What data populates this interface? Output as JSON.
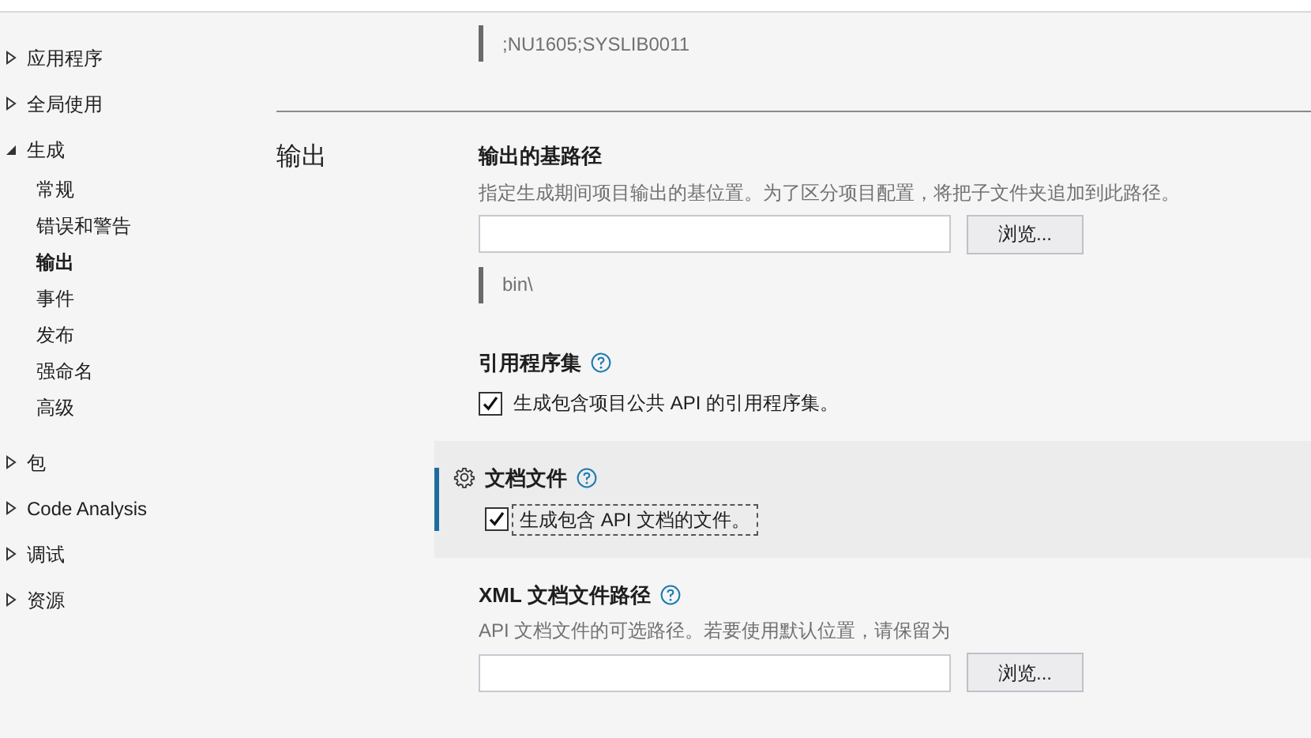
{
  "sidebar": {
    "items": [
      {
        "label": "应用程序",
        "expanded": false,
        "selected": false
      },
      {
        "label": "全局使用",
        "expanded": false,
        "selected": false
      },
      {
        "label": "生成",
        "expanded": true,
        "selected": false,
        "children": [
          {
            "label": "常规",
            "selected": false
          },
          {
            "label": "错误和警告",
            "selected": false
          },
          {
            "label": "输出",
            "selected": true
          },
          {
            "label": "事件",
            "selected": false
          },
          {
            "label": "发布",
            "selected": false
          },
          {
            "label": "强命名",
            "selected": false
          },
          {
            "label": "高级",
            "selected": false
          }
        ]
      },
      {
        "label": "包",
        "expanded": false,
        "selected": false
      },
      {
        "label": "Code Analysis",
        "expanded": false,
        "selected": false
      },
      {
        "label": "调试",
        "expanded": false,
        "selected": false
      },
      {
        "label": "资源",
        "expanded": false,
        "selected": false
      }
    ]
  },
  "top_value": ";NU1605;SYSLIB0011",
  "section": {
    "title": "输出",
    "settings": [
      {
        "kind": "path",
        "title": "输出的基路径",
        "help": false,
        "highlighted": false,
        "description": "指定生成期间项目输出的基位置。为了区分项目配置，将把子文件夹追加到此路径。",
        "button": "浏览...",
        "evaluated": "bin\\"
      },
      {
        "kind": "checkbox",
        "title": "引用程序集",
        "help": true,
        "highlighted": false,
        "label": "生成包含项目公共 API 的引用程序集。",
        "checked": true,
        "focused": false
      },
      {
        "kind": "checkbox",
        "title": "文档文件",
        "help": true,
        "highlighted": true,
        "label": "生成包含 API 文档的文件。",
        "checked": true,
        "focused": true
      },
      {
        "kind": "path",
        "title": "XML 文档文件路径",
        "help": true,
        "highlighted": false,
        "description": "API 文档文件的可选路径。若要使用默认位置，请保留为",
        "button": "浏览..."
      }
    ]
  }
}
